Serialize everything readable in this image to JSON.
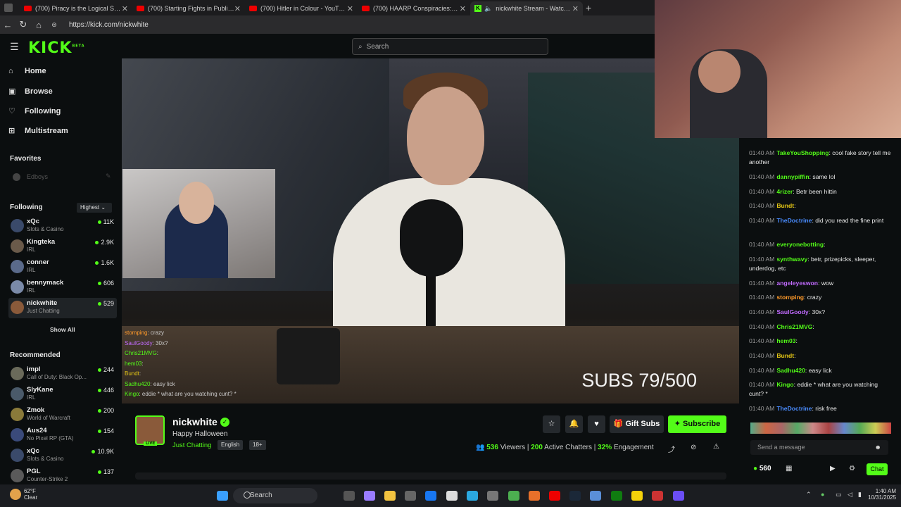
{
  "browser": {
    "tabs": [
      {
        "title": "(700) Piracy is the Logical Solution"
      },
      {
        "title": "(700) Starting Fights in Public Pra"
      },
      {
        "title": "(700) Hitler in Colour - YouTube"
      },
      {
        "title": "(700) HAARP Conspiracies: Was T"
      },
      {
        "title": "nickwhite Stream - Watch Li"
      }
    ],
    "url": "https://kick.com/nickwhite"
  },
  "site": {
    "logo": "KICK",
    "logo_sup": "BETA",
    "search_placeholder": "Search"
  },
  "nav": {
    "home": "Home",
    "browse": "Browse",
    "following": "Following",
    "multistream": "Multistream"
  },
  "favorites": {
    "heading": "Favorites",
    "item": "Edboys"
  },
  "following": {
    "heading": "Following",
    "sort": "Highest",
    "show_all": "Show All",
    "channels": [
      {
        "name": "xQc",
        "cat": "Slots & Casino",
        "viewers": "11K",
        "color": "#3a4a6a"
      },
      {
        "name": "Kingteka",
        "cat": "IRL",
        "viewers": "2.9K",
        "color": "#6a5a4a"
      },
      {
        "name": "conner",
        "cat": "IRL",
        "viewers": "1.6K",
        "color": "#5a6a8a"
      },
      {
        "name": "bennymack",
        "cat": "IRL",
        "viewers": "606",
        "color": "#7a8aa8"
      },
      {
        "name": "nickwhite",
        "cat": "Just Chatting",
        "viewers": "529",
        "color": "#8a5a3a"
      }
    ]
  },
  "recommended": {
    "heading": "Recommended",
    "channels": [
      {
        "name": "impl",
        "cat": "Call of Duty: Black Op...",
        "viewers": "244",
        "color": "#6a6a5a"
      },
      {
        "name": "SlyKane",
        "cat": "IRL",
        "viewers": "446",
        "color": "#4a5a6a"
      },
      {
        "name": "Zmok",
        "cat": "World of Warcraft",
        "viewers": "200",
        "color": "#8a7a3a"
      },
      {
        "name": "Aus24",
        "cat": "No Pixel RP (GTA)",
        "viewers": "154",
        "color": "#3a4a7a"
      },
      {
        "name": "xQc",
        "cat": "Slots & Casino",
        "viewers": "10.9K",
        "color": "#3a4a6a"
      },
      {
        "name": "PGL",
        "cat": "Counter-Strike 2",
        "viewers": "137",
        "color": "#5a5a5a"
      }
    ]
  },
  "video": {
    "subs": "SUBS 79/500",
    "pip_chat": [
      {
        "user": "stomping",
        "text": ": crazy"
      },
      {
        "user": "SaulGoody",
        "text": ": 30x?"
      },
      {
        "user": "Chris21MVG",
        "text": ":"
      },
      {
        "user": "hem03",
        "text": ":"
      },
      {
        "user": "Bundt",
        "text": ":"
      },
      {
        "user": "Sadhu420",
        "text": ": easy lick"
      },
      {
        "user": "Kingo",
        "text": ": eddie * what are you watching cunt? *"
      }
    ]
  },
  "stream": {
    "name": "nickwhite",
    "title": "Happy Halloween",
    "category": "Just Chatting",
    "tags": [
      "English",
      "18+"
    ],
    "live": "LIVE",
    "gift": "Gift Subs",
    "subscribe": "Subscribe",
    "viewers": "536",
    "viewers_label": "Viewers",
    "chatters": "200",
    "chatters_label": "Active Chatters",
    "engagement": "32%",
    "engagement_label": "Engagement"
  },
  "chat": {
    "messages": [
      {
        "ts": "01:40 AM",
        "user": "TakeYouShopping",
        "color": "#53fc18",
        "text": ": cool fake story tell me another"
      },
      {
        "ts": "01:40 AM",
        "user": "dannypiffin",
        "color": "#53fc18",
        "text": ": same lol"
      },
      {
        "ts": "01:40 AM",
        "user": "4rizer",
        "color": "#53fc18",
        "text": ": Betr been hittin"
      },
      {
        "ts": "01:40 AM",
        "user": "Bundt",
        "color": "#e3c515",
        "text": ":"
      },
      {
        "ts": "01:40 AM",
        "user": "TheDoctrine",
        "color": "#4a8cff",
        "text": ": did you read the fine print"
      },
      {
        "ts": "01:40 AM",
        "user": "everyonebotting",
        "color": "#53fc18",
        "text": ":"
      },
      {
        "ts": "01:40 AM",
        "user": "synthwavy",
        "color": "#53fc18",
        "text": ": betr, prizepicks, sleeper, underdog, etc"
      },
      {
        "ts": "01:40 AM",
        "user": "angeleyeswon",
        "color": "#c26bff",
        "text": ": wow"
      },
      {
        "ts": "01:40 AM",
        "user": "stomping",
        "color": "#ff9a2a",
        "text": ": crazy"
      },
      {
        "ts": "01:40 AM",
        "user": "SaulGoody",
        "color": "#c26bff",
        "text": ": 30x?"
      },
      {
        "ts": "01:40 AM",
        "user": "Chris21MVG",
        "color": "#53fc18",
        "text": ":"
      },
      {
        "ts": "01:40 AM",
        "user": "hem03",
        "color": "#53fc18",
        "text": ":"
      },
      {
        "ts": "01:40 AM",
        "user": "Bundt",
        "color": "#e3c515",
        "text": ":"
      },
      {
        "ts": "01:40 AM",
        "user": "Sadhu420",
        "color": "#53fc18",
        "text": ": easy lick"
      },
      {
        "ts": "01:40 AM",
        "user": "Kingo",
        "color": "#53fc18",
        "text": ": eddie * what are you watching cunt? *"
      },
      {
        "ts": "01:40 AM",
        "user": "TheDoctrine",
        "color": "#4a8cff",
        "text": ": risk free"
      }
    ],
    "placeholder": "Send a message",
    "points": "560",
    "chat_btn": "Chat"
  },
  "taskbar": {
    "temp": "62°F",
    "weather": "Clear",
    "search": "Search",
    "time": "1:40 AM",
    "date": "10/31/2025"
  }
}
